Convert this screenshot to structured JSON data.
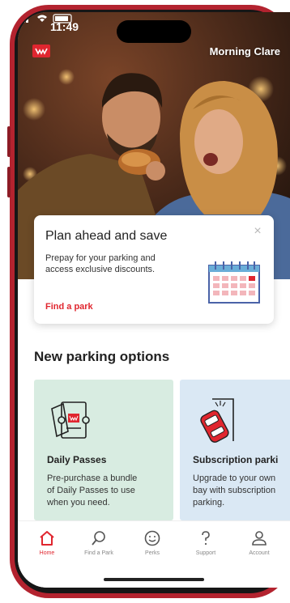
{
  "status_bar": {
    "time": "11:49"
  },
  "header": {
    "greeting": "Morning Clare"
  },
  "promo_card": {
    "title": "Plan ahead and save",
    "description": "Prepay for your parking and access exclusive discounts.",
    "link_label": "Find a park",
    "close_icon": "close-icon"
  },
  "section": {
    "title": "New parking options"
  },
  "options": [
    {
      "title": "Daily Passes",
      "description_lines": [
        "Pre-purchase a bundle",
        "of Daily Passes to use",
        "when you need."
      ],
      "icon": "ticket-icon"
    },
    {
      "title": "Subscription parki",
      "description_lines": [
        "Upgrade to your own",
        "bay with subscription",
        "parking."
      ],
      "icon": "car-bay-icon"
    }
  ],
  "bottom_nav": {
    "items": [
      {
        "label": "Home",
        "icon": "home-icon",
        "active": true
      },
      {
        "label": "Find a Park",
        "icon": "search-icon",
        "active": false
      },
      {
        "label": "Perks",
        "icon": "smiley-icon",
        "active": false
      },
      {
        "label": "Support",
        "icon": "question-icon",
        "active": false
      },
      {
        "label": "Account",
        "icon": "account-icon",
        "active": false
      }
    ]
  },
  "colors": {
    "brand": "#e0262f",
    "phone_frame": "#b3232f",
    "daily_card": "#d8ece1",
    "subscription_card": "#dae8f4"
  }
}
